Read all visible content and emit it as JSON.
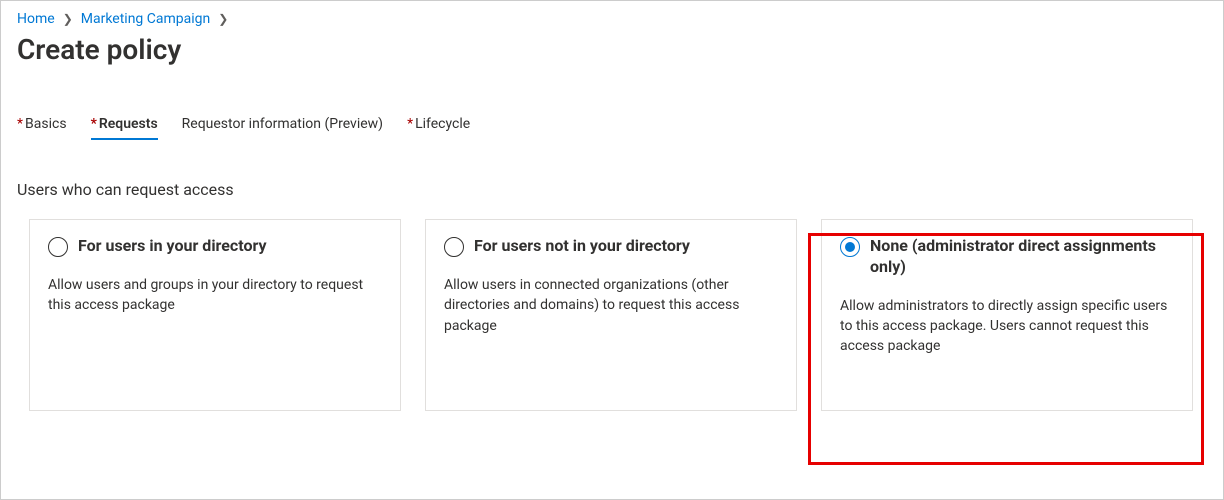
{
  "breadcrumb": {
    "items": [
      {
        "label": "Home"
      },
      {
        "label": "Marketing Campaign"
      }
    ]
  },
  "page_title": "Create policy",
  "tabs": [
    {
      "label": "Basics",
      "required": true,
      "active": false
    },
    {
      "label": "Requests",
      "required": true,
      "active": true
    },
    {
      "label": "Requestor information (Preview)",
      "required": false,
      "active": false
    },
    {
      "label": "Lifecycle",
      "required": true,
      "active": false
    }
  ],
  "section_label": "Users who can request access",
  "options": [
    {
      "title": "For users in your directory",
      "desc": "Allow users and groups in your directory to request this access package",
      "selected": false
    },
    {
      "title": "For users not in your directory",
      "desc": "Allow users in connected organizations (other directories and domains) to request this access package",
      "selected": false
    },
    {
      "title": "None (administrator direct assignments only)",
      "desc": "Allow administrators to directly assign specific users to this access package. Users cannot request this access package",
      "selected": true
    }
  ]
}
